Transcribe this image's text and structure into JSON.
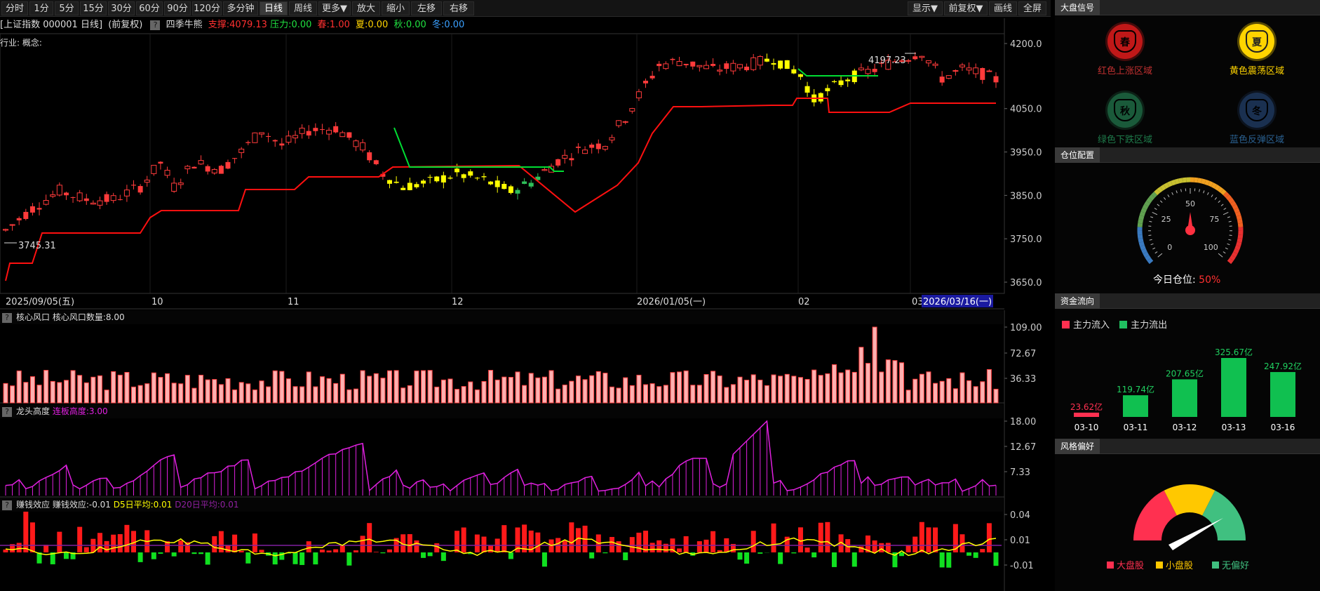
{
  "toolbar": {
    "periods": [
      "分时",
      "1分",
      "5分",
      "15分",
      "30分",
      "60分",
      "90分",
      "120分",
      "多分钟",
      "日线",
      "周线",
      "更多▼",
      "放大",
      "缩小",
      "左移",
      "右移"
    ],
    "active": "日线",
    "right": [
      "显示▼",
      "前复权▼",
      "画线",
      "全屏"
    ]
  },
  "info": {
    "title": "[上证指数 000001 日线]",
    "adjust": "(前复权)",
    "indicator_name": "四季牛熊",
    "support": "支撑:4079.13",
    "pressure": "压力:0.00",
    "spring": "春:1.00",
    "summer": "夏:0.00",
    "autumn": "秋:0.00",
    "winter": "冬:0.00",
    "industry": "行业: 概念:"
  },
  "colors": {
    "up": "#ff3b3b",
    "down": "#1fd35a",
    "yellow": "#ffff00",
    "green": "#00cc33",
    "magenta": "#e020e0",
    "red_line": "#ff1010"
  },
  "price_axis": {
    "labels": [
      "4200.0",
      "4050.0",
      "3950.0",
      "3850.0",
      "3750.0",
      "3650.0"
    ],
    "values": [
      4200,
      4050,
      3950,
      3850,
      3750,
      3650
    ]
  },
  "price_marks": {
    "high_label": "4197.23",
    "low_label": "3745.31"
  },
  "date_axis": {
    "labels": [
      "2025/09/05(五)",
      "10",
      "11",
      "12",
      "2026/01/05(一)",
      "02",
      "03"
    ],
    "cursor": "2026/03/16(一)"
  },
  "panels": [
    {
      "title": "核心风口",
      "value_label": "核心风口数量:8.00",
      "axis": [
        "109.00",
        "72.67",
        "36.33"
      ]
    },
    {
      "title": "龙头高度",
      "value_label": "连板高度:3.00",
      "axis": [
        "18.00",
        "12.67",
        "7.33"
      ]
    },
    {
      "title": "赚钱效应",
      "value_label": "赚钱效应:-0.01",
      "d5": "D5日平均:0.01",
      "d20": "D20日平均:0.01",
      "axis": [
        "0.04",
        "0.01",
        "-0.01"
      ]
    }
  ],
  "right_panel": {
    "signal": {
      "header": "大盘信号",
      "items": [
        {
          "glyph": "春",
          "label": "红色上涨区域",
          "color": "#c01818",
          "label_color": "#c03030",
          "active": false
        },
        {
          "glyph": "夏",
          "label": "黄色震荡区域",
          "color": "#ffd400",
          "label_color": "#ffd400",
          "active": true
        },
        {
          "glyph": "秋",
          "label": "绿色下跌区域",
          "color": "#1a5a3a",
          "label_color": "#1e7a4a",
          "active": false
        },
        {
          "glyph": "冬",
          "label": "蓝色反弹区域",
          "color": "#1a3050",
          "label_color": "#2a6090",
          "active": false
        }
      ]
    },
    "position": {
      "header": "仓位配置",
      "ticks": [
        "0",
        "25",
        "50",
        "75",
        "100"
      ],
      "label": "今日仓位:",
      "value": "50%",
      "level": 50
    },
    "flow": {
      "header": "资金流向",
      "legend_in": "主力流入",
      "legend_out": "主力流出",
      "bars": [
        {
          "date": "03-10",
          "value": 23.62,
          "label": "23.62亿",
          "type": "out"
        },
        {
          "date": "03-11",
          "value": 119.74,
          "label": "119.74亿",
          "type": "in"
        },
        {
          "date": "03-12",
          "value": 207.65,
          "label": "207.65亿",
          "type": "in"
        },
        {
          "date": "03-13",
          "value": 325.67,
          "label": "325.67亿",
          "type": "in"
        },
        {
          "date": "03-16",
          "value": 247.92,
          "label": "247.92亿",
          "type": "in"
        }
      ]
    },
    "style": {
      "header": "风格偏好",
      "legend": [
        "大盘股",
        "小盘股",
        "无偏好"
      ],
      "colors": [
        "#ff3050",
        "#ffc800",
        "#40c080"
      ]
    }
  }
}
